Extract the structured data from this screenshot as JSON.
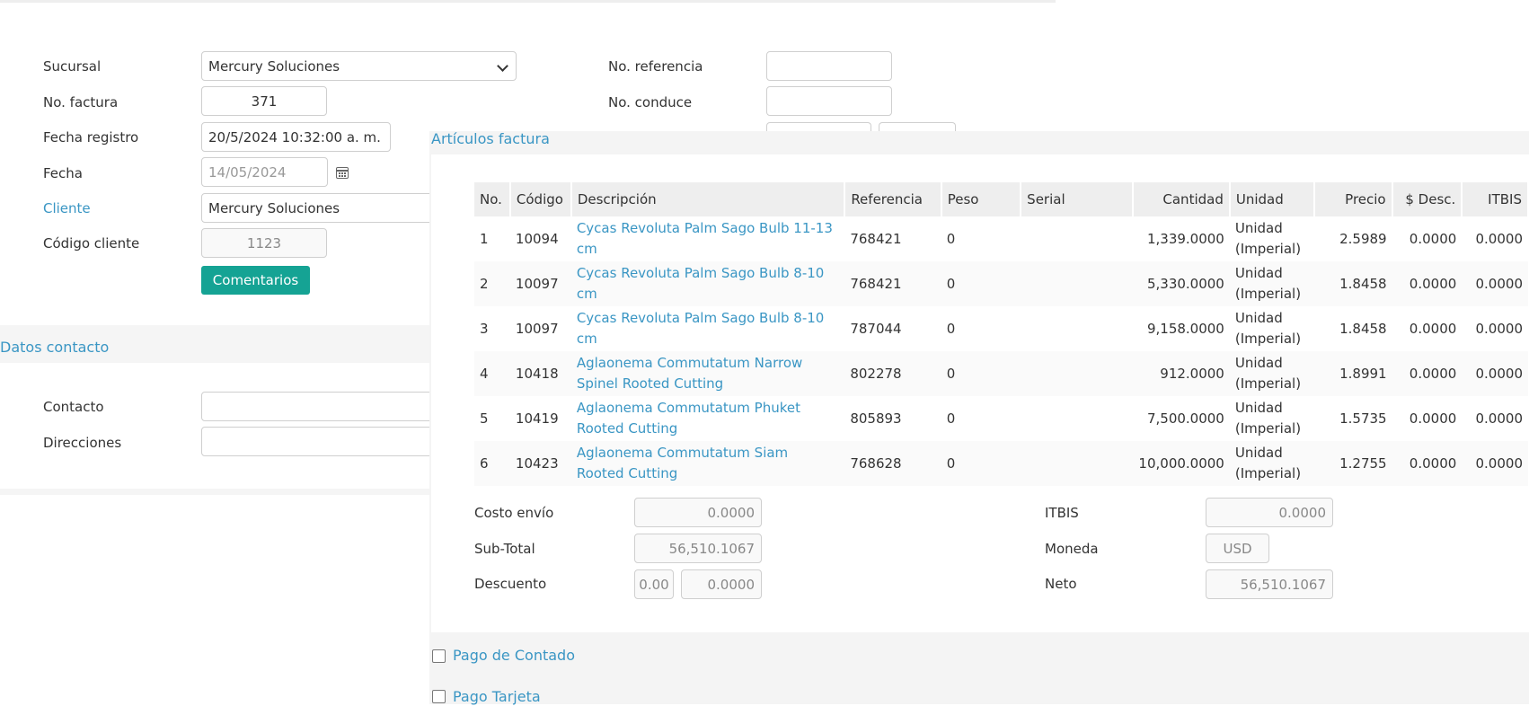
{
  "form": {
    "sucursal_label": "Sucursal",
    "sucursal_value": "Mercury Soluciones",
    "factura_label": "No. factura",
    "factura_value": "371",
    "fecha_registro_label": "Fecha registro",
    "fecha_registro_value": "20/5/2024 10:32:00 a. m.",
    "fecha_label": "Fecha",
    "fecha_value": "14/05/2024",
    "cliente_label": "Cliente",
    "cliente_value": "Mercury Soluciones",
    "codigo_cliente_label": "Código cliente",
    "codigo_cliente_value": "1123",
    "comentarios_button": "Comentarios",
    "referencia_label": "No. referencia",
    "conduce_label": "No. conduce"
  },
  "contacto": {
    "title": "Datos contacto",
    "contacto_label": "Contacto",
    "direcciones_label": "Direcciones"
  },
  "articulos": {
    "title": "Artículos factura",
    "columns": [
      "No.",
      "Código",
      "Descripción",
      "Referencia",
      "Peso",
      "Serial",
      "Cantidad",
      "Unidad",
      "Precio",
      "$ Desc.",
      "ITBIS"
    ],
    "rows": [
      {
        "no": "1",
        "codigo": "10094",
        "descripcion": "Cycas Revoluta Palm Sago Bulb 11-13 cm",
        "referencia": "768421",
        "peso": "0",
        "serial": "",
        "cantidad": "1,339.0000",
        "unidad": "Unidad (Imperial)",
        "precio": "2.5989",
        "desc": "0.0000",
        "itbis": "0.0000"
      },
      {
        "no": "2",
        "codigo": "10097",
        "descripcion": "Cycas Revoluta Palm Sago Bulb 8-10 cm",
        "referencia": "768421",
        "peso": "0",
        "serial": "",
        "cantidad": "5,330.0000",
        "unidad": "Unidad (Imperial)",
        "precio": "1.8458",
        "desc": "0.0000",
        "itbis": "0.0000"
      },
      {
        "no": "3",
        "codigo": "10097",
        "descripcion": "Cycas Revoluta Palm Sago Bulb 8-10 cm",
        "referencia": "787044",
        "peso": "0",
        "serial": "",
        "cantidad": "9,158.0000",
        "unidad": "Unidad (Imperial)",
        "precio": "1.8458",
        "desc": "0.0000",
        "itbis": "0.0000"
      },
      {
        "no": "4",
        "codigo": "10418",
        "descripcion": "Aglaonema Commutatum Narrow Spinel Rooted Cutting",
        "referencia": "802278",
        "peso": "0",
        "serial": "",
        "cantidad": "912.0000",
        "unidad": "Unidad (Imperial)",
        "precio": "1.8991",
        "desc": "0.0000",
        "itbis": "0.0000"
      },
      {
        "no": "5",
        "codigo": "10419",
        "descripcion": "Aglaonema Commutatum Phuket Rooted Cutting",
        "referencia": "805893",
        "peso": "0",
        "serial": "",
        "cantidad": "7,500.0000",
        "unidad": "Unidad (Imperial)",
        "precio": "1.5735",
        "desc": "0.0000",
        "itbis": "0.0000"
      },
      {
        "no": "6",
        "codigo": "10423",
        "descripcion": "Aglaonema Commutatum Siam Rooted Cutting",
        "referencia": "768628",
        "peso": "0",
        "serial": "",
        "cantidad": "10,000.0000",
        "unidad": "Unidad (Imperial)",
        "precio": "1.2755",
        "desc": "0.0000",
        "itbis": "0.0000"
      }
    ]
  },
  "totales": {
    "costo_envio_label": "Costo envío",
    "costo_envio_value": "0.0000",
    "subtotal_label": "Sub-Total",
    "subtotal_value": "56,510.1067",
    "descuento_label": "Descuento",
    "descuento_pct": "0.00",
    "descuento_value": "0.0000",
    "itbis_label": "ITBIS",
    "itbis_value": "0.0000",
    "moneda_label": "Moneda",
    "moneda_value": "USD",
    "neto_label": "Neto",
    "neto_value": "56,510.1067"
  },
  "pagos": {
    "contado_label": "Pago de Contado",
    "tarjeta_label": "Pago Tarjeta"
  }
}
